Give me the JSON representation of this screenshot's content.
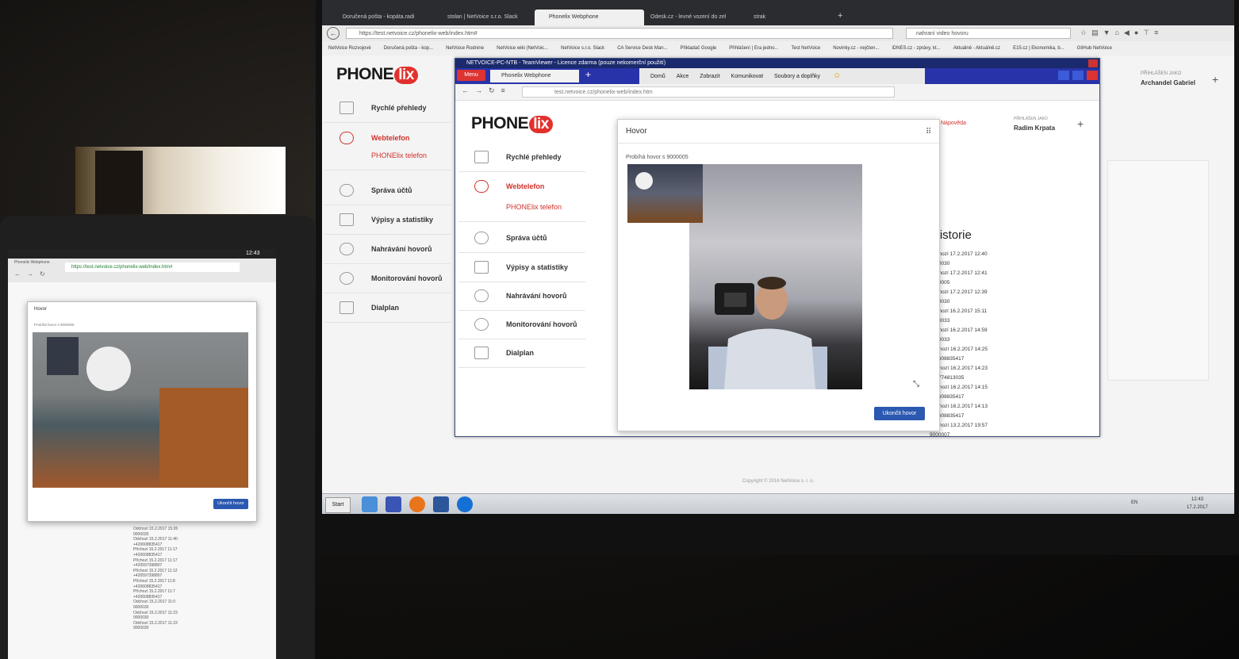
{
  "monitor": {
    "browser_tabs": [
      {
        "label": "Doručená pošta - kopáta.radi"
      },
      {
        "label": "stolan | NetVoice s.r.o. Slack"
      },
      {
        "label": "Phonelix Webphone"
      },
      {
        "label": "Odesk.cz - levné vození do zel"
      },
      {
        "label": "strak"
      }
    ],
    "url": "https://test.netvoice.cz/phonelix-web/index.htm#",
    "search_text": "nahraní video hovoru",
    "bookmarks": [
      "NetVoice Rozvojové",
      "Doručená pošta - kop...",
      "NetVoice Rodnine",
      "NetVoice wiki (NetVoic...",
      "NetVoice s.r.o. Slack",
      "CA Service Desk Man...",
      "Přikladač Google",
      "Přihlášení | Era jedno...",
      "Test NetVoice",
      "Novinky.cz - nejčten...",
      "iDNES.cz - zprávy, kt...",
      "Aktuálně - Aktuálně.cz",
      "E15.cz | Ekonomika, b...",
      "GitHub NetVoice"
    ],
    "app": {
      "logo_left": "PHONE",
      "logo_right": "lix",
      "sidebar": [
        {
          "label": "Rychlé přehledy"
        },
        {
          "label": "Webtelefon"
        },
        {
          "label": "PHONElix telefon"
        },
        {
          "label": "Správa účtů"
        },
        {
          "label": "Výpisy a statistiky"
        },
        {
          "label": "Nahrávání hovorů"
        },
        {
          "label": "Monitorování hovorů"
        },
        {
          "label": "Dialplan"
        }
      ],
      "logged_in_caption": "PŘIHLÁŠEN JAKO",
      "logged_in_user": "Archandel Gabriel",
      "footer": "Copyright © 2016 NetVoice s. r. o."
    },
    "taskbar": {
      "start": "Start",
      "lang": "EN",
      "time": "12:43",
      "date": "17.2.2017"
    },
    "teamviewer": {
      "title": "NETVOICE-PC-NTB - TeamViewer - Licence zdarma (pouze nekomerční použití)",
      "menu": "Menu",
      "tab": "Phonelix Webphone",
      "tools": [
        "Domů",
        "Akce",
        "Zobrazit",
        "Komunikovat",
        "Soubory a doplňky"
      ],
      "url": "test.netvoice.cz/phonelix-web/index.htm",
      "logged_in_caption": "PŘIHLÁŠEN JAKO",
      "logged_in_user": "Radim Krpata",
      "help": "Nápověda",
      "historie_title": "Historie",
      "historie": [
        "Příchozí 17.2.2017 12:40",
        "9000030",
        "Příchozí 17.2.2017 12:41",
        "9000005",
        "Příchozí 17.2.2017 12:39",
        "9000030",
        "Příchozí 16.2.2017 15:11",
        "9000033",
        "Příchozí 16.2.2017 14:59",
        "9000033",
        "Odchozí 16.2.2017 14:25",
        "420608835417",
        "Odchozí 16.2.2017 14:23",
        "420774813035",
        "Odchozí 16.2.2017 14:15",
        "420608835417",
        "Odchozí 16.2.2017 14:13",
        "420608835417",
        "Odchozí 13.2.2017 19:57",
        "9000007"
      ]
    },
    "call": {
      "title": "Hovor",
      "status": "Probíhá hovor s 9000005",
      "end_button": "Ukončit hovor"
    }
  },
  "tablet": {
    "status_time": "12:43",
    "tab_label": "Phonelix Webphone",
    "url": "https://test.netvoice.cz/phonelix-web/index.htm#",
    "call_title": "Hovor",
    "call_status": "Probíhá hovor s 9000005",
    "end_button": "Ukončit hovor",
    "history": [
      "Odchozí 15.2.2017 15:26",
      "9000030",
      "Odchozí 15.2.2017 11:40",
      "+420608835417",
      "Příchozí 15.2.2017 11:17",
      "+420608835417",
      "Příchozí 15.2.2017 11:17",
      "+420597398807",
      "Příchozí 15.2.2017 11:12",
      "+420597398807",
      "Příchozí 15.2.2017 11:8",
      "+420608835417",
      "Příchozí 15.2.2017 11:7",
      "+420608835417",
      "Odchozí 15.2.2017 11:0",
      "9000030",
      "Odchozí 15.2.2017 11:23",
      "9000030",
      "Odchozí 15.2.2017 11:23",
      "9000030"
    ]
  }
}
